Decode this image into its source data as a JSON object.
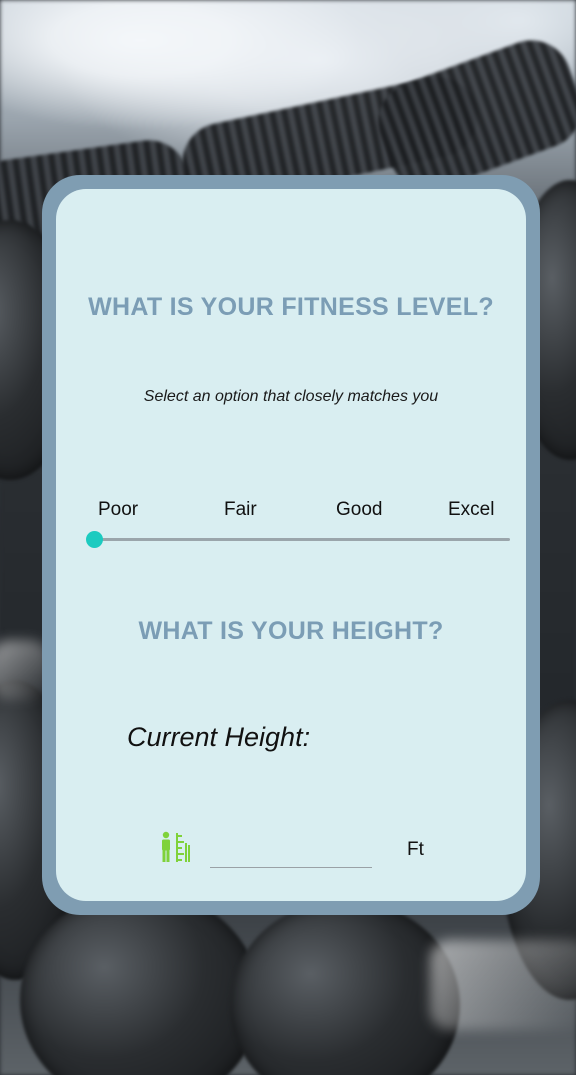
{
  "fitness": {
    "title": "WHAT IS YOUR FITNESS LEVEL?",
    "subtitle": "Select an option that closely matches you",
    "levels": [
      "Poor",
      "Fair",
      "Good",
      "Excel"
    ],
    "selected_index": 0,
    "slider_value": 0
  },
  "height": {
    "title": "WHAT IS YOUR HEIGHT?",
    "current_label": "Current Height:",
    "input_value": "",
    "unit": "Ft",
    "icon": "height-person-icon"
  },
  "colors": {
    "card_border": "#7f9db2",
    "card_background": "#d9eef1",
    "heading": "#7b9db5",
    "slider_thumb": "#1ccbc0",
    "slider_track": "#9aa5ab",
    "icon": "#7fd23a"
  }
}
